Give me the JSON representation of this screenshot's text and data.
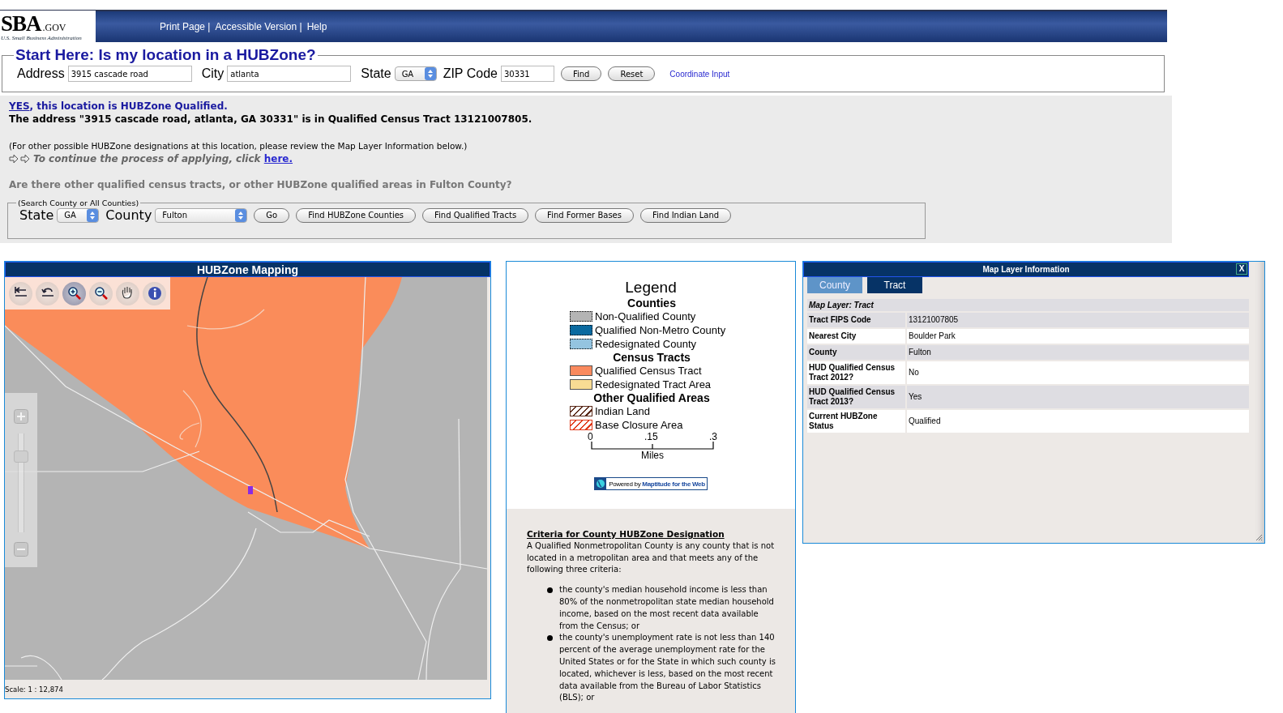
{
  "header": {
    "logo": {
      "mark": "SBA",
      "suffix": ".GOV",
      "tagline": "U.S. Small Business Administration"
    },
    "links": [
      "Print Page |",
      "Accessible Version |",
      "Help"
    ]
  },
  "search_form": {
    "legend": "Start Here: Is my location in a HUBZone?",
    "fields": [
      {
        "kind": "text",
        "label": "Address",
        "value": "3915 cascade road"
      },
      {
        "kind": "text",
        "label": "City",
        "value": "atlanta"
      },
      {
        "kind": "select",
        "label": "State",
        "value": "GA"
      },
      {
        "kind": "zip",
        "label": "ZIP Code",
        "value": "30331"
      }
    ],
    "buttons": [
      "Find",
      "Reset"
    ],
    "link": "Coordinate Input"
  },
  "result": {
    "answer_link": "YES",
    "answer_rest": ", this location is HUBZone Qualified.",
    "detail": "The address \"3915 cascade road, atlanta, GA 30331\" is in Qualified Census Tract 13121007805.",
    "note": "(For other possible HUBZone designations at this location, please review the Map Layer Information below.)",
    "continue_text": "To continue the process of applying, click",
    "continue_link": "here.",
    "question": "Are there other qualified census tracts, or other HUBZone qualified areas in Fulton County?"
  },
  "county_search": {
    "legend": "(Search County or All Counties)",
    "fields": [
      {
        "kind": "small",
        "label": "State",
        "value": "GA"
      },
      {
        "kind": "wide",
        "label": "County",
        "value": "Fulton"
      }
    ],
    "buttons": [
      "Go",
      "Find HUBZone Counties",
      "Find Qualified Tracts",
      "Find Former Bases",
      "Find Indian Land"
    ]
  },
  "map": {
    "title": "HUBZone Mapping",
    "tools": [
      {
        "kind": "full-extent",
        "selected": false
      },
      {
        "kind": "previous",
        "selected": false
      },
      {
        "kind": "zoom-in",
        "selected": true
      },
      {
        "kind": "zoom-out",
        "selected": false
      },
      {
        "kind": "pan",
        "selected": false
      },
      {
        "kind": "info",
        "selected": false
      }
    ],
    "zoom_slider": {
      "level": 0.8
    },
    "scale": "Scale: 1 : 12,874"
  },
  "legend": {
    "title": "Legend",
    "sections": [
      {
        "heading": "Counties",
        "items": [
          {
            "label": "Non-Qualified County",
            "kind": "dotted",
            "color": "#b4b4b4"
          },
          {
            "label": "Qualified Non-Metro County",
            "kind": "dotted",
            "color": "#0a6aa0"
          },
          {
            "label": "Redesignated County",
            "kind": "dotted",
            "color": "#94c4e0"
          }
        ]
      },
      {
        "heading": "Census Tracts",
        "items": [
          {
            "label": "Qualified Census Tract",
            "kind": "solid",
            "color": "#fa8a5e"
          },
          {
            "label": "Redesignated Tract Area",
            "kind": "solid",
            "color": "#f8dc94"
          }
        ]
      },
      {
        "heading": "Other Qualified Areas",
        "items": [
          {
            "label": "Indian Land",
            "kind": "hatch",
            "color": "#5a2a1a"
          },
          {
            "label": "Base Closure Area",
            "kind": "hatch",
            "color": "#e03a1a"
          }
        ]
      }
    ],
    "scale_ticks": [
      "0",
      ".15",
      ".3"
    ],
    "scale_unit": "Miles",
    "powered_by": "Powered by",
    "product": "Maptitude for the Web"
  },
  "criteria": {
    "heading": "Criteria for County HUBZone Designation",
    "intro": "A Qualified Nonmetropolitan County is any county that is not located in a metropolitan area and that meets any of the following three criteria:",
    "bullets": [
      "the county's median household income is less than 80% of the nonmetropolitan state median household income, based on the most recent data available from the Census; or",
      "the county's unemployment rate is not less than 140 percent of the average unemployment rate for the United States or for the State in which such county is located, whichever is less, based on the most recent data available from the Bureau of Labor Statistics (BLS); or"
    ]
  },
  "layer_info": {
    "title": "Map Layer Information",
    "close": "X",
    "tabs": [
      {
        "label": "County",
        "selected": false
      },
      {
        "label": "Tract",
        "selected": true
      }
    ],
    "caption": "Map Layer: Tract",
    "rows": [
      {
        "label": "Tract FIPS Code",
        "value": "13121007805"
      },
      {
        "label": "Nearest City",
        "value": "Boulder Park"
      },
      {
        "label": "County",
        "value": "Fulton"
      },
      {
        "label": "HUD Qualified Census Tract 2012?",
        "value": "No"
      },
      {
        "label": "HUD Qualified Census Tract 2013?",
        "value": "Yes"
      },
      {
        "label": "Current HUBZone Status",
        "value": "Qualified"
      }
    ]
  }
}
